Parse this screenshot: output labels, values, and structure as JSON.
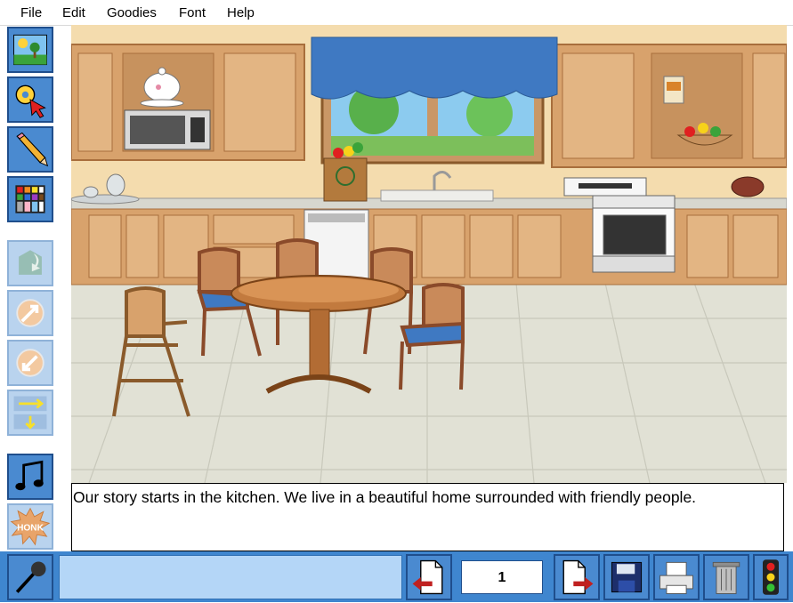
{
  "menu": {
    "items": [
      "File",
      "Edit",
      "Goodies",
      "Font",
      "Help"
    ]
  },
  "toolbar": {
    "tools": [
      {
        "name": "background-picker",
        "icon": "landscape-icon",
        "enabled": true
      },
      {
        "name": "sticker-picker",
        "icon": "pointer-icon",
        "enabled": true
      },
      {
        "name": "draw-tool",
        "icon": "pencil-icon",
        "enabled": true
      },
      {
        "name": "color-palette",
        "icon": "palette-icon",
        "enabled": true
      },
      {
        "name": "flip-tool",
        "icon": "flip-icon",
        "enabled": false
      },
      {
        "name": "enlarge-tool",
        "icon": "grow-icon",
        "enabled": false
      },
      {
        "name": "shrink-tool",
        "icon": "shrink-icon",
        "enabled": false
      },
      {
        "name": "move-layer-tool",
        "icon": "layer-arrows-icon",
        "enabled": false
      },
      {
        "name": "music-tool",
        "icon": "music-note-icon",
        "enabled": true
      },
      {
        "name": "sound-effect-tool",
        "icon": "honk-icon",
        "enabled": true,
        "label": "HONK"
      }
    ]
  },
  "story": {
    "text": "Our story starts in the kitchen. We live in a beautiful home surrounded with friendly people."
  },
  "bottom": {
    "page_number": "1",
    "buttons": [
      "previous-page",
      "next-page",
      "save",
      "print",
      "trash",
      "traffic-light"
    ]
  },
  "colors": {
    "toolbar_blue": "#4a8ad0",
    "bar_blue": "#3f86cf",
    "field_blue": "#b4d6f7"
  }
}
